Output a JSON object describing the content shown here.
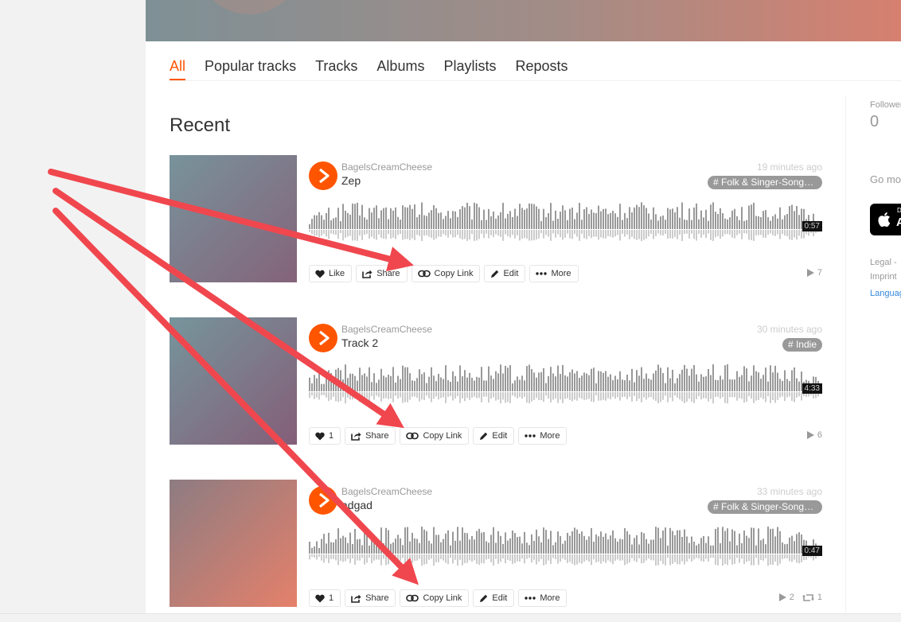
{
  "tabs": [
    {
      "label": "All",
      "active": true
    },
    {
      "label": "Popular tracks",
      "active": false
    },
    {
      "label": "Tracks",
      "active": false
    },
    {
      "label": "Albums",
      "active": false
    },
    {
      "label": "Playlists",
      "active": false
    },
    {
      "label": "Reposts",
      "active": false
    }
  ],
  "section_title": "Recent",
  "tracks": [
    {
      "uploader": "BagelsCreamCheese",
      "title": "Zep",
      "time_ago": "19 minutes ago",
      "tag": "# Folk & Singer-Songwriter",
      "duration": "0:57",
      "like_label": "Like",
      "share_label": "Share",
      "copy_link_label": "Copy Link",
      "edit_label": "Edit",
      "more_label": "More",
      "plays": "7",
      "reposts": "",
      "artwork_colors": [
        "#78939b",
        "#84637a"
      ]
    },
    {
      "uploader": "BagelsCreamCheese",
      "title": "Track 2",
      "time_ago": "30 minutes ago",
      "tag": "# Indie",
      "duration": "4:33",
      "like_label": "1",
      "share_label": "Share",
      "copy_link_label": "Copy Link",
      "edit_label": "Edit",
      "more_label": "More",
      "plays": "6",
      "reposts": "",
      "artwork_colors": [
        "#76959c",
        "#845e78"
      ]
    },
    {
      "uploader": "BagelsCreamCheese",
      "title": "adgad",
      "time_ago": "33 minutes ago",
      "tag": "# Folk & Singer-Songwriter",
      "duration": "0:47",
      "like_label": "1",
      "share_label": "Share",
      "copy_link_label": "Copy Link",
      "edit_label": "Edit",
      "more_label": "More",
      "plays": "2",
      "reposts": "1",
      "artwork_colors": [
        "#8d7c82",
        "#e5806a"
      ]
    }
  ],
  "sidebar": {
    "followers_label": "Followers",
    "followers_count": "0",
    "go_mobile": "Go mobile",
    "app_store_small": "D",
    "app_store_letter": "A",
    "legal": "Legal -",
    "imprint": "Imprint",
    "language": "Language"
  },
  "colors": {
    "accent": "#ff5500",
    "annotation_arrow": "#f0474e"
  },
  "icons": [
    "play-icon",
    "heart-icon",
    "share-icon",
    "link-icon",
    "pencil-icon",
    "more-icon",
    "play-count-icon",
    "repost-icon",
    "apple-icon"
  ]
}
